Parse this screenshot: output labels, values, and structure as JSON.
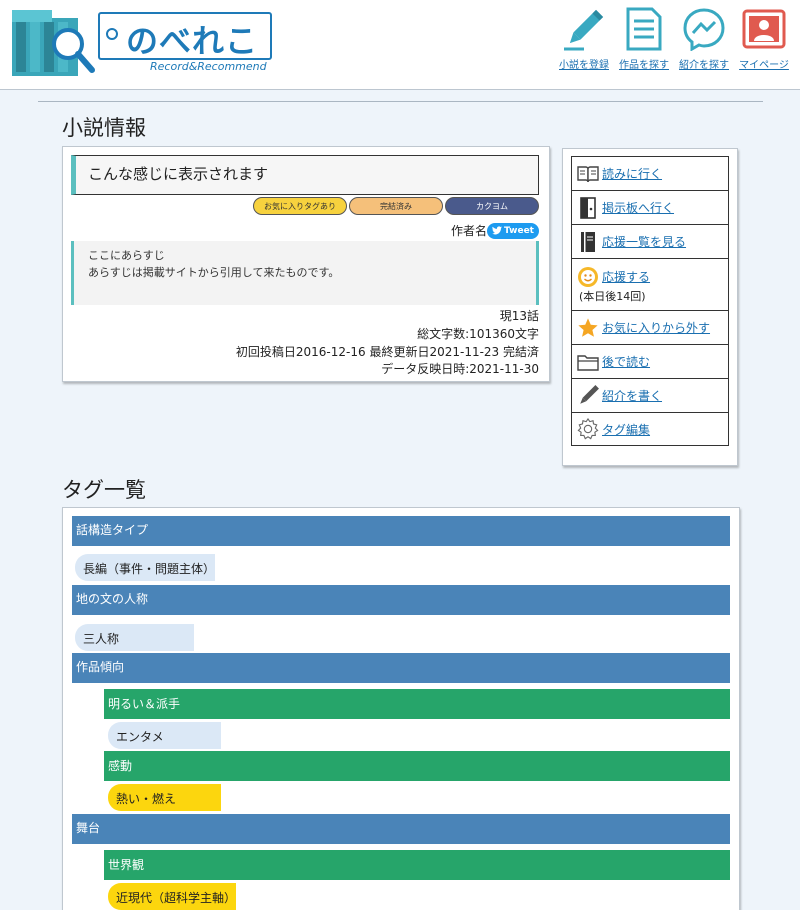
{
  "header": {
    "logo_text": "のべれこ",
    "logo_sub": "Record&Recommend",
    "nav": [
      {
        "label": "小説を登録",
        "icon": "pencil-icon"
      },
      {
        "label": "作品を探す",
        "icon": "document-icon"
      },
      {
        "label": "紹介を探す",
        "icon": "messenger-icon"
      },
      {
        "label": "マイページ",
        "icon": "profile-icon"
      }
    ]
  },
  "novel_section": {
    "heading": "小説情報",
    "title": "こんな感じに表示されます",
    "badges": [
      "お気に入りタグあり",
      "完結済み",
      "カクヨム"
    ],
    "author": "作者名",
    "tweet_label": "Tweet",
    "synopsis": [
      "ここにあらすじ",
      "あらすじは掲載サイトから引用して来たものです。"
    ],
    "episodes": "現13話",
    "word_count": "総文字数:101360文字",
    "dates": "初回投稿日2016-12-16 最終更新日2021-11-23 完結済",
    "reflected": "データ反映日時:2021-11-30"
  },
  "actions": [
    {
      "label": "読みに行く",
      "icon": "book-open-icon"
    },
    {
      "label": "掲示板へ行く",
      "icon": "door-icon"
    },
    {
      "label": "応援一覧を見る",
      "icon": "notebook-icon"
    },
    {
      "label": "応援する",
      "icon": "cheer-icon",
      "sub": "(本日後14回)"
    },
    {
      "label": "お気に入りから外す",
      "icon": "star-icon"
    },
    {
      "label": "後で読む",
      "icon": "folder-icon"
    },
    {
      "label": "紹介を書く",
      "icon": "pen-icon"
    },
    {
      "label": "タグ編集",
      "icon": "gear-icon"
    }
  ],
  "tags_section": {
    "heading": "タグ一覧",
    "groups": [
      {
        "name": "話構造タイプ",
        "tag": "長編（事件・問題主体）"
      },
      {
        "name": "地の文の人称",
        "tag": "三人称"
      },
      {
        "name": "作品傾向",
        "subgroups": [
          {
            "name": "明るい＆派手",
            "tag": "エンタメ"
          },
          {
            "name": "感動",
            "tag": "熱い・燃え"
          }
        ]
      },
      {
        "name": "舞台",
        "subgroups": [
          {
            "name": "世界観",
            "tag": "近現代（超科学主軸）"
          }
        ]
      }
    ]
  },
  "colors": {
    "category": "#4a84b8",
    "subcategory": "#26a56a",
    "tag_blue": "#dbe8f6",
    "tag_yellow": "#fcd60e",
    "accent": "#5bbfbf",
    "link": "#1a6fb0"
  }
}
